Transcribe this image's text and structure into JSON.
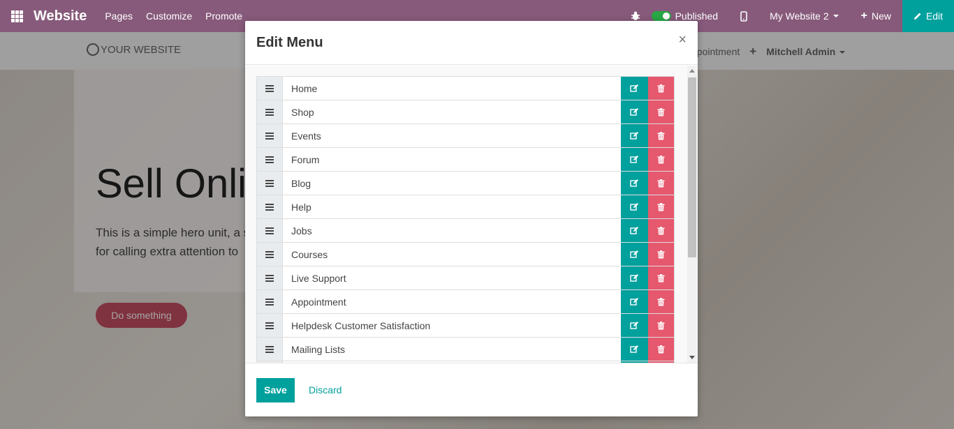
{
  "topbar": {
    "app_name": "Website",
    "nav": [
      "Pages",
      "Customize",
      "Promote"
    ],
    "published_label": "Published",
    "website_switch": "My Website 2",
    "new_label": "New",
    "edit_label": "Edit"
  },
  "site": {
    "logo_text": "YOUR WEBSITE",
    "nav_partial": "ppointment",
    "plus": "+",
    "user": "Mitchell Admin"
  },
  "hero": {
    "title": "Sell Onli",
    "text": "This is a simple hero unit, a s for calling extra attention to",
    "button": "Do something"
  },
  "modal": {
    "title": "Edit Menu",
    "close": "×",
    "items": [
      {
        "label": "Home"
      },
      {
        "label": "Shop"
      },
      {
        "label": "Events"
      },
      {
        "label": "Forum"
      },
      {
        "label": "Blog"
      },
      {
        "label": "Help"
      },
      {
        "label": "Jobs"
      },
      {
        "label": "Courses"
      },
      {
        "label": "Live Support"
      },
      {
        "label": "Appointment"
      },
      {
        "label": "Helpdesk Customer Satisfaction"
      },
      {
        "label": "Mailing Lists"
      },
      {
        "label": ""
      }
    ],
    "save_label": "Save",
    "discard_label": "Discard"
  },
  "colors": {
    "topbar": "#875a7b",
    "accent": "#00a09d",
    "danger": "#e6586e"
  }
}
